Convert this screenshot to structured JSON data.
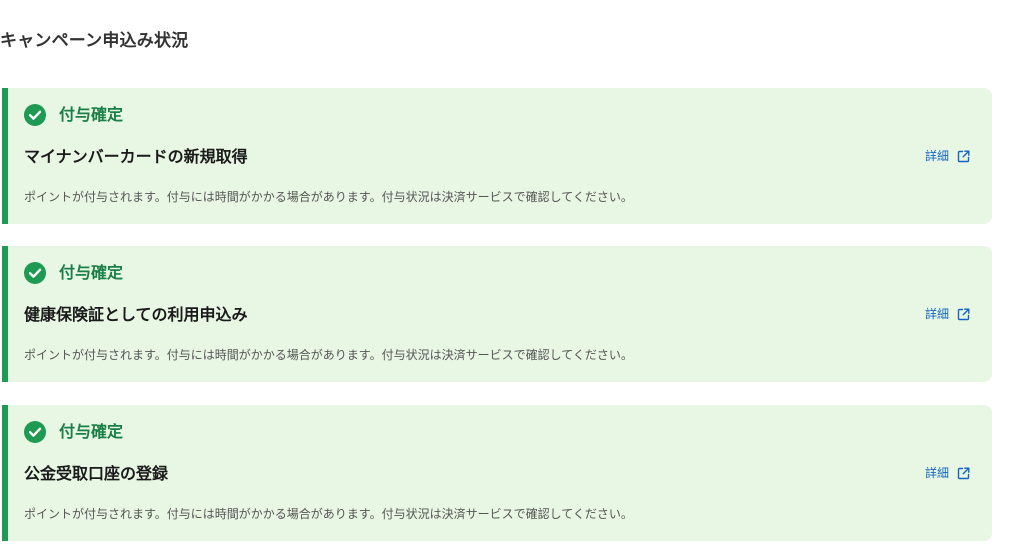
{
  "page": {
    "title": "キャンペーン申込み状況"
  },
  "cards": [
    {
      "status": "付与確定",
      "title": "マイナンバーカードの新規取得",
      "link_label": "詳細",
      "description": "ポイントが付与されます。付与には時間がかかる場合があります。付与状況は決済サービスで確認してください。"
    },
    {
      "status": "付与確定",
      "title": "健康保険証としての利用申込み",
      "link_label": "詳細",
      "description": "ポイントが付与されます。付与には時間がかかる場合があります。付与状況は決済サービスで確認してください。"
    },
    {
      "status": "付与確定",
      "title": "公金受取口座の登録",
      "link_label": "詳細",
      "description": "ポイントが付与されます。付与には時間がかかる場合があります。付与状況は決済サービスで確認してください。"
    }
  ],
  "icons": {
    "status": "check-circle-icon",
    "link": "external-link-icon"
  },
  "colors": {
    "accent_green": "#1f9a52",
    "status_text": "#1a7f46",
    "card_background": "#e8f6e4",
    "link_blue": "#1565c0"
  }
}
